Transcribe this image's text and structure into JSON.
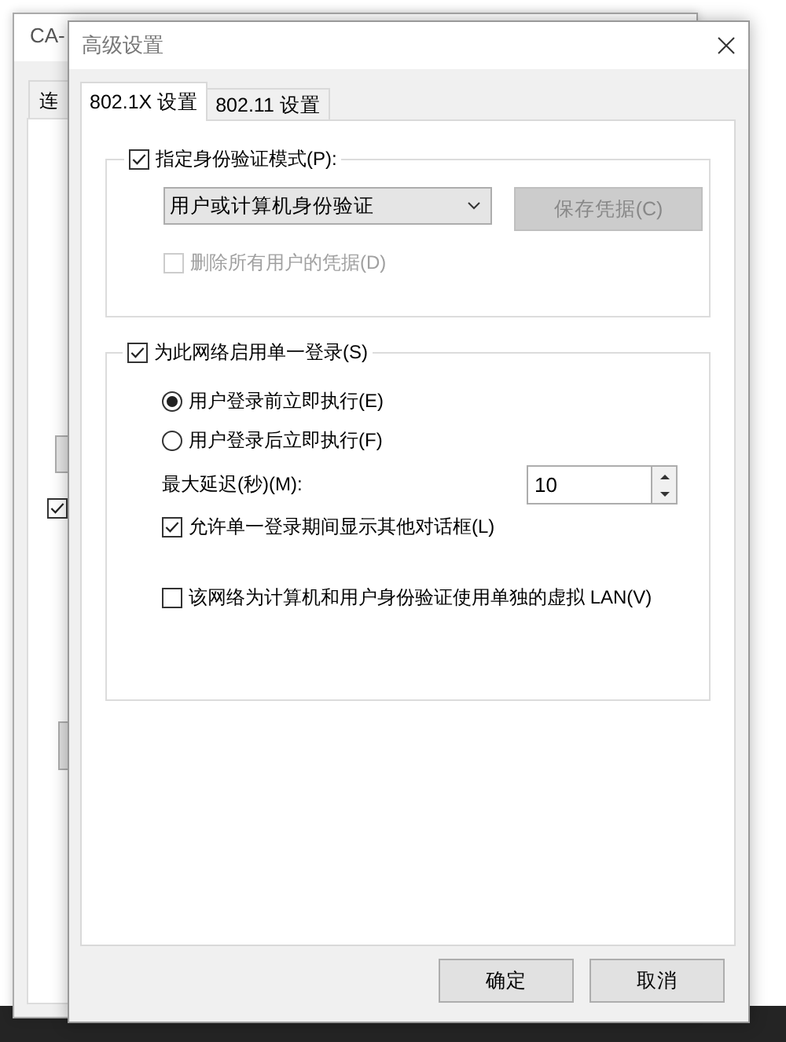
{
  "background_window": {
    "title": "CA-",
    "tab": "连",
    "checkbox_checked": true
  },
  "dialog": {
    "title": "高级设置",
    "tabs": [
      {
        "label": "802.1X 设置",
        "selected": true
      },
      {
        "label": "802.11 设置",
        "selected": false
      }
    ],
    "auth_group": {
      "checkbox": {
        "label": "指定身份验证模式(P):",
        "checked": true
      },
      "dropdown": {
        "value": "用户或计算机身份验证"
      },
      "save_button": {
        "label": "保存凭据(C)",
        "disabled": true
      },
      "delete_checkbox": {
        "label": "删除所有用户的凭据(D)",
        "checked": false,
        "disabled": true
      }
    },
    "sso_group": {
      "checkbox": {
        "label": "为此网络启用单一登录(S)",
        "checked": true
      },
      "radios": [
        {
          "label": "用户登录前立即执行(E)",
          "selected": true
        },
        {
          "label": "用户登录后立即执行(F)",
          "selected": false
        }
      ],
      "delay": {
        "label": "最大延迟(秒)(M):",
        "value": "10"
      },
      "options": [
        {
          "label": "允许单一登录期间显示其他对话框(L)",
          "checked": true
        },
        {
          "label": "该网络为计算机和用户身份验证使用单独的虚拟 LAN(V)",
          "checked": false
        }
      ]
    },
    "buttons": [
      "确定",
      "取消"
    ]
  }
}
